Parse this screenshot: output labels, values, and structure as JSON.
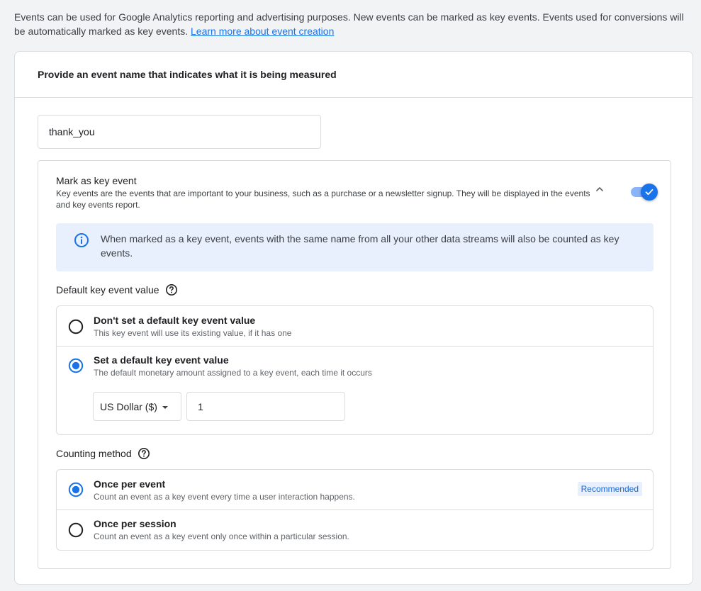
{
  "intro": {
    "text": "Events can be used for Google Analytics reporting and advertising purposes. New events can be marked as key events. Events used for conversions will be automatically marked as key events.",
    "link": "Learn more about event creation"
  },
  "card": {
    "header": "Provide an event name that indicates what it is being measured",
    "event_name_value": "thank_you"
  },
  "key_event": {
    "title": "Mark as key event",
    "description": "Key events are the events that are important to your business, such as a purchase or a newsletter signup. They will be displayed in the events and key events report.",
    "toggle_on": true,
    "info": "When marked as a key event, events with the same name from all your other data streams will also be counted as key events."
  },
  "default_value": {
    "label": "Default key event value",
    "options": [
      {
        "title": "Don't set a default key event value",
        "description": "This key event will use its existing value, if it has one",
        "selected": false
      },
      {
        "title": "Set a default key event value",
        "description": "The default monetary amount assigned to a key event, each time it occurs",
        "selected": true
      }
    ],
    "currency": "US Dollar ($)",
    "amount": "1"
  },
  "counting": {
    "label": "Counting method",
    "options": [
      {
        "title": "Once per event",
        "description": "Count an event as a key event every time a user interaction happens.",
        "selected": true,
        "badge": "Recommended"
      },
      {
        "title": "Once per session",
        "description": "Count an event as a key event only once within a particular session.",
        "selected": false
      }
    ]
  },
  "colors": {
    "accent": "#1a73e8",
    "info_bg": "#e8f0fe",
    "border": "#dadce0",
    "page_bg": "#f1f3f4"
  }
}
